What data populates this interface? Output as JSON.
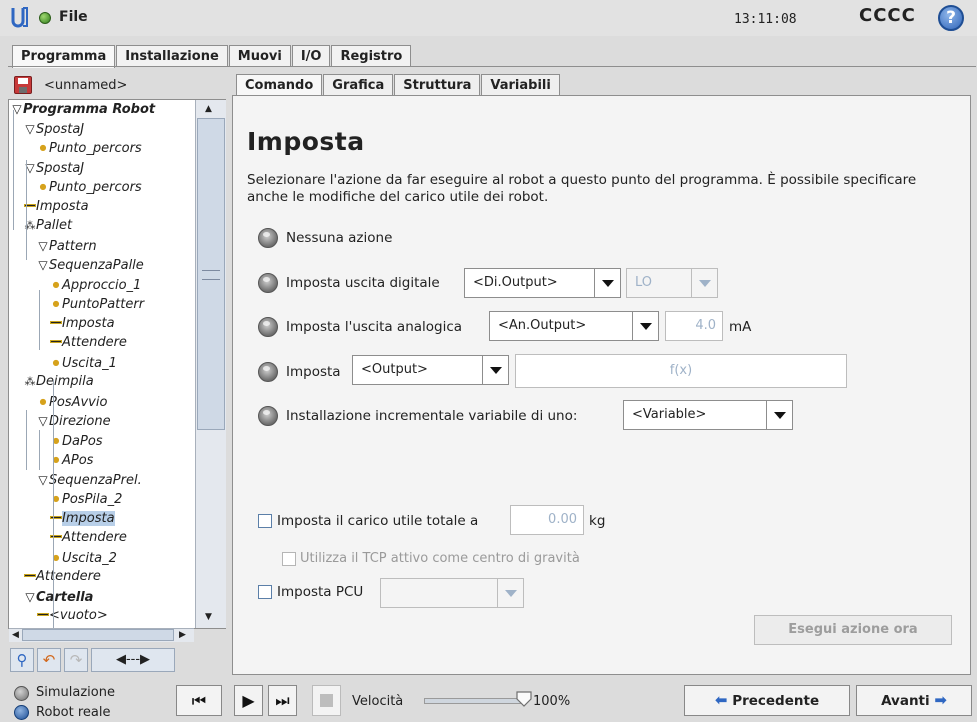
{
  "header": {
    "file_label": "File",
    "clock": "13:11:08",
    "robot_name": "CCCC",
    "help_glyph": "?"
  },
  "main_tabs": [
    {
      "label": "Programma",
      "active": true
    },
    {
      "label": "Installazione",
      "active": false
    },
    {
      "label": "Muovi",
      "active": false
    },
    {
      "label": "I/O",
      "active": false
    },
    {
      "label": "Registro",
      "active": false
    }
  ],
  "program_name": "<unnamed>",
  "tree": [
    {
      "label": "Programma Robot",
      "icon": "tri",
      "bold": true
    },
    {
      "label": "SpostaJ",
      "icon": "tri"
    },
    {
      "label": "Punto_percors",
      "icon": "dot"
    },
    {
      "label": "SpostaJ",
      "icon": "tri"
    },
    {
      "label": "Punto_percors",
      "icon": "dot"
    },
    {
      "label": "Imposta",
      "icon": "dash"
    },
    {
      "label": "Pallet",
      "icon": "pallet"
    },
    {
      "label": "Pattern",
      "icon": "tri"
    },
    {
      "label": "SequenzaPalle",
      "icon": "tri"
    },
    {
      "label": "Approccio_1",
      "icon": "dot"
    },
    {
      "label": "PuntoPatterr",
      "icon": "dot"
    },
    {
      "label": "Imposta",
      "icon": "dash"
    },
    {
      "label": "Attendere",
      "icon": "dash"
    },
    {
      "label": "Uscita_1",
      "icon": "dot"
    },
    {
      "label": "Deimpila",
      "icon": "pallet"
    },
    {
      "label": "PosAvvio",
      "icon": "dot"
    },
    {
      "label": "Direzione",
      "icon": "tri"
    },
    {
      "label": "DaPos",
      "icon": "dot"
    },
    {
      "label": "APos",
      "icon": "dot"
    },
    {
      "label": "SequenzaPrel.",
      "icon": "tri"
    },
    {
      "label": "PosPila_2",
      "icon": "dot"
    },
    {
      "label": "Imposta",
      "icon": "dash",
      "selected": true
    },
    {
      "label": "Attendere",
      "icon": "dash"
    },
    {
      "label": "Uscita_2",
      "icon": "dot"
    },
    {
      "label": "Attendere",
      "icon": "dash"
    },
    {
      "label": "Cartella",
      "icon": "tri",
      "bold": true
    },
    {
      "label": "<vuoto>",
      "icon": "dash"
    }
  ],
  "left_toolbar": {
    "icons": [
      "search-icon",
      "undo-icon",
      "redo-icon",
      "move-arrows-icon"
    ],
    "move_glyph": "◀---▶"
  },
  "sub_tabs": [
    {
      "label": "Comando",
      "active": true
    },
    {
      "label": "Grafica",
      "active": false
    },
    {
      "label": "Struttura",
      "active": false
    },
    {
      "label": "Variabili",
      "active": false
    }
  ],
  "command": {
    "title": "Imposta",
    "description": "Selezionare l'azione da far eseguire al robot a questo punto del programma. È possibile specificare anche le modifiche del carico utile dei robot.",
    "option_none": "Nessuna azione",
    "option_digital": "Imposta uscita digitale",
    "digital_output": "<Di.Output>",
    "digital_value": "LO",
    "option_analog": "Imposta l'uscita analogica",
    "analog_output": "<An.Output>",
    "analog_value": "4.0",
    "analog_unit": "mA",
    "option_set": "Imposta",
    "set_output": "<Output>",
    "set_expression": "f(x)",
    "option_increment": "Installazione incrementale variabile di uno:",
    "increment_variable": "<Variable>",
    "payload_label": "Imposta il carico utile totale a",
    "payload_value": "0.00",
    "payload_unit": "kg",
    "tcp_cog_label": "Utilizza il TCP attivo come centro di gravità",
    "tcp_label": "Imposta PCU",
    "tcp_value": "",
    "run_now_button": "Esegui azione ora"
  },
  "footer": {
    "mode_simulation": "Simulazione",
    "mode_real": "Robot reale",
    "speed_label": "Velocità",
    "speed_percent": "100%",
    "speed_fraction": 1.0,
    "prev_button": "Precedente",
    "next_button": "Avanti"
  },
  "colors": {
    "accent_blue": "#2f67c2",
    "status_green": "#3f9a25",
    "selection": "#b8cfe8"
  }
}
